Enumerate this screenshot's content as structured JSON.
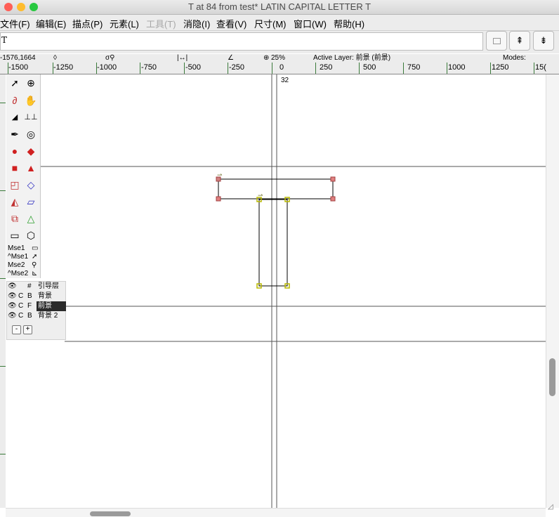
{
  "window": {
    "title": "T at 84 from test* LATIN CAPITAL LETTER T"
  },
  "menubar": {
    "items": [
      {
        "label": "文件(F)",
        "enabled": true
      },
      {
        "label": "编辑(E)",
        "enabled": true
      },
      {
        "label": "描点(P)",
        "enabled": true
      },
      {
        "label": "元素(L)",
        "enabled": true
      },
      {
        "label": "工具(T)",
        "enabled": false
      },
      {
        "label": "消隐(I)",
        "enabled": true
      },
      {
        "label": "查看(V)",
        "enabled": true
      },
      {
        "label": "尺寸(M)",
        "enabled": true
      },
      {
        "label": "窗口(W)",
        "enabled": true
      },
      {
        "label": "帮助(H)",
        "enabled": true
      }
    ]
  },
  "glyph_field": {
    "value": "T"
  },
  "info": {
    "coords": "-1576,1664",
    "zoom": "25%",
    "active_layer": "Active Layer: 前景 (前景)",
    "modes": "Modes:"
  },
  "ruler": {
    "labels": [
      "-1500",
      "-1250",
      "-1000",
      "-750",
      "-500",
      "-250",
      "0",
      "250",
      "500",
      "750",
      "1000",
      "1250",
      "15("
    ]
  },
  "canvas": {
    "advance_label": "32"
  },
  "mouse_bindings": [
    "Mse1",
    "^Mse1",
    "Mse2",
    "^Mse2"
  ],
  "layers": {
    "header": {
      "num": "#",
      "name": "引导层"
    },
    "rows": [
      {
        "c": "C",
        "type": "B",
        "name": "背景",
        "active": false
      },
      {
        "c": "C",
        "type": "F",
        "name": "前景",
        "active": true
      },
      {
        "c": "C",
        "type": "B",
        "name": "背景 2",
        "active": false
      }
    ],
    "minus": "-",
    "plus": "+"
  },
  "colors": {
    "ruler_tick": "#3a7a3a",
    "point_yellow": "#c8c800",
    "point_red": "#e06060",
    "selected_layer_bg": "#2a2a2a"
  }
}
